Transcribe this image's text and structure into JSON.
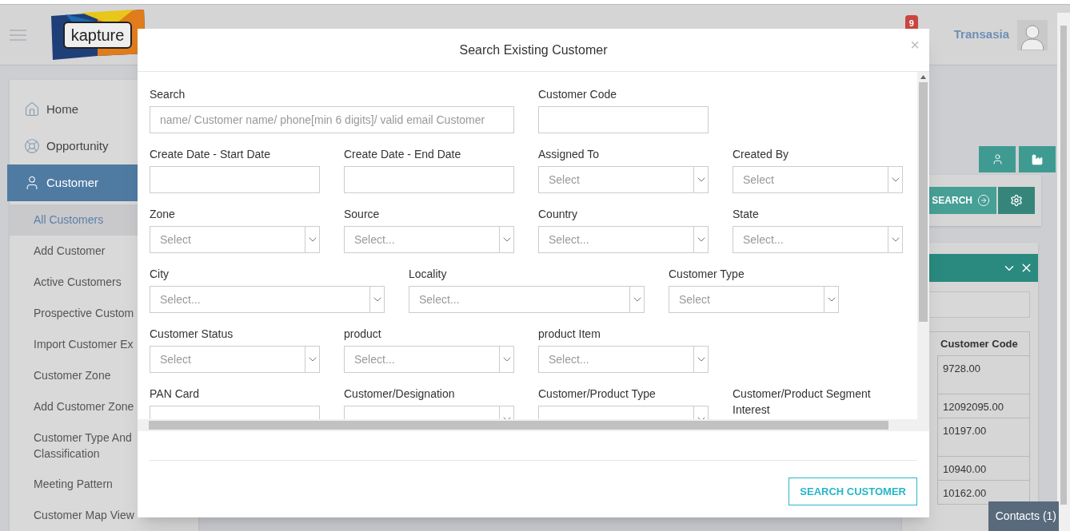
{
  "header": {
    "logo_text": "kapture",
    "notification_count": "9",
    "user_name": "Transasia"
  },
  "sidebar": {
    "items": [
      {
        "label": "Home",
        "selected": false
      },
      {
        "label": "Opportunity",
        "selected": false
      },
      {
        "label": "Customer",
        "selected": true
      }
    ],
    "subitems": [
      {
        "label": "All Customers",
        "selected": true
      },
      {
        "label": "Add Customer",
        "selected": false
      },
      {
        "label": "Active Customers",
        "selected": false
      },
      {
        "label": "Prospective Custom",
        "selected": false
      },
      {
        "label": "Import Customer Ex",
        "selected": false
      },
      {
        "label": "Customer Zone",
        "selected": false
      },
      {
        "label": "Add Customer Zone",
        "selected": false
      },
      {
        "label": "Customer Type And Classification",
        "selected": false
      },
      {
        "label": "Meeting Pattern",
        "selected": false
      },
      {
        "label": "Customer Map View",
        "selected": false
      }
    ]
  },
  "toolbar": {
    "search_button": "SEARCH"
  },
  "table": {
    "columns": [
      "Customer Code"
    ],
    "rows": [
      {
        "cells": [
          "9728.00"
        ],
        "kind": "tall"
      },
      {
        "cells": [
          "12092095.00"
        ],
        "kind": "short"
      },
      {
        "cells": [
          "10197.00"
        ],
        "kind": "tall"
      },
      {
        "cells": [
          "10940.00"
        ],
        "kind": "short"
      },
      {
        "cells": [
          "10162.00"
        ],
        "kind": "short"
      }
    ]
  },
  "contacts_tab": "Contacts (1)",
  "modal": {
    "title": "Search Existing Customer",
    "close": "×",
    "submit": "SEARCH CUSTOMER",
    "rows": [
      {
        "kind": "four_column",
        "fields": [
          {
            "label": "Search",
            "kind": "wide_text",
            "placeholder": "name/ Customer name/ phone[min 6 digits]/ valid email Customer"
          },
          {
            "label": "Customer Code",
            "kind": "text"
          }
        ]
      },
      {
        "kind": "four_column",
        "fields": [
          {
            "label": "Create Date - Start Date",
            "kind": "text"
          },
          {
            "label": "Create Date - End Date",
            "kind": "text"
          },
          {
            "label": "Assigned To",
            "kind": "select",
            "placeholder": "Select"
          },
          {
            "label": "Created By",
            "kind": "select",
            "placeholder": "Select"
          }
        ]
      },
      {
        "kind": "four_column",
        "fields": [
          {
            "label": "Zone",
            "kind": "select",
            "placeholder": "Select"
          },
          {
            "label": "Source",
            "kind": "select",
            "placeholder": "Select..."
          },
          {
            "label": "Country",
            "kind": "select",
            "placeholder": "Select..."
          },
          {
            "label": "State",
            "kind": "select",
            "placeholder": "Select..."
          }
        ]
      },
      {
        "kind": "three_column",
        "fields": [
          {
            "label": "City",
            "kind": "select",
            "placeholder": "Select..."
          },
          {
            "label": "Locality",
            "kind": "select",
            "placeholder": "Select..."
          },
          {
            "label": "Customer Type",
            "kind": "select",
            "placeholder": "Select"
          }
        ]
      },
      {
        "kind": "four_column",
        "fields": [
          {
            "label": "Customer Status",
            "kind": "select",
            "placeholder": "Select"
          },
          {
            "label": "product",
            "kind": "select",
            "placeholder": "Select..."
          },
          {
            "label": "product Item",
            "kind": "select",
            "placeholder": "Select..."
          }
        ]
      },
      {
        "kind": "four_column",
        "fields": [
          {
            "label": "PAN Card",
            "kind": "text"
          },
          {
            "label": "Customer/Designation",
            "kind": "select"
          },
          {
            "label": "Customer/Product Type",
            "kind": "select"
          },
          {
            "label": "Customer/Product Segment Interest",
            "kind": "label_only"
          }
        ]
      }
    ]
  }
}
